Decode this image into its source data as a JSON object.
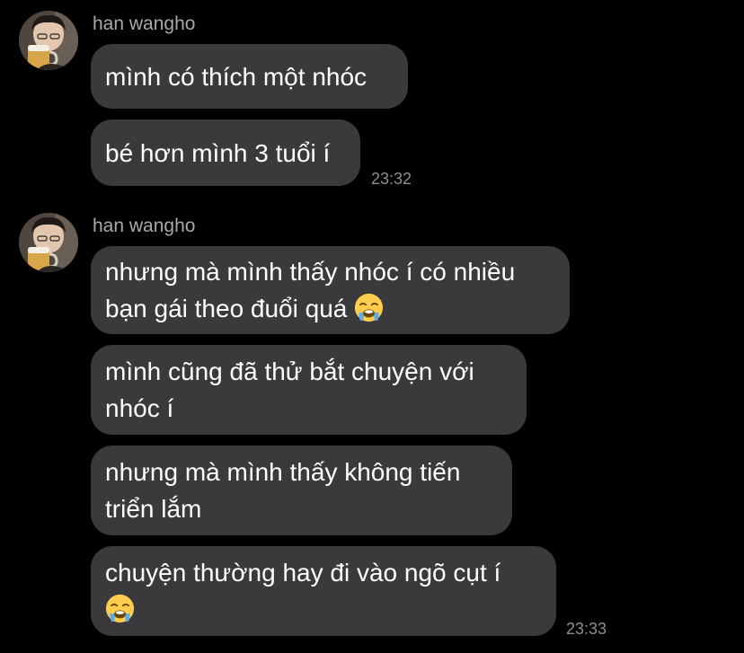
{
  "groups": [
    {
      "sender": "han wangho",
      "messages": [
        {
          "text": "mình có thích một nhóc"
        },
        {
          "text": "bé hơn mình 3 tuổi í"
        }
      ],
      "time": "23:32"
    },
    {
      "sender": "han wangho",
      "messages": [
        {
          "line1": "nhưng mà mình thấy nhóc í có nhiều",
          "line2": "bạn gái theo đuổi quá",
          "emoji": "loudly-crying-face-emoji"
        },
        {
          "line1": "mình cũng đã thử bắt chuyện với",
          "line2": "nhóc í"
        },
        {
          "line1": "nhưng mà mình thấy không tiến",
          "line2": "triển lắm"
        },
        {
          "line1": "chuyện thường hay đi vào ngõ cụt í",
          "emoji": "loudly-crying-face-emoji"
        }
      ],
      "time": "23:33"
    }
  ],
  "colors": {
    "background": "#000000",
    "bubble": "#3a3a3c",
    "sender": "#a9a9a9",
    "time": "#8e8e93"
  }
}
